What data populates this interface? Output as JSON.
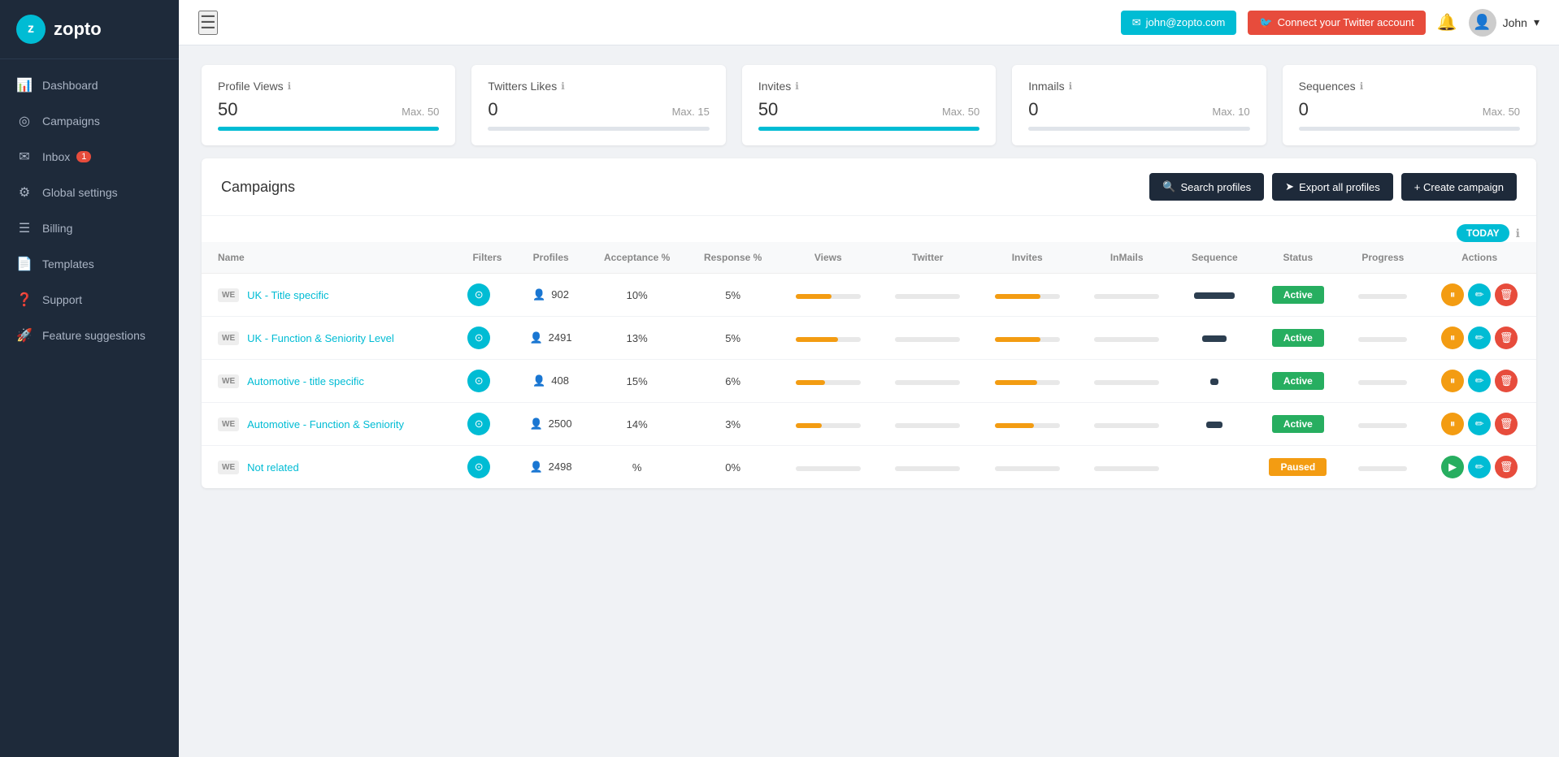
{
  "app": {
    "name": "zopto",
    "logo_letter": "z"
  },
  "topbar": {
    "hamburger_label": "☰",
    "email_btn": "john@zopto.com",
    "twitter_btn": "Connect your Twitter account",
    "user_name": "John",
    "bell_icon": "🔔"
  },
  "sidebar": {
    "items": [
      {
        "id": "dashboard",
        "label": "Dashboard",
        "icon": "📊",
        "badge": null
      },
      {
        "id": "campaigns",
        "label": "Campaigns",
        "icon": "◎",
        "badge": null
      },
      {
        "id": "inbox",
        "label": "Inbox",
        "icon": "✉",
        "badge": "1"
      },
      {
        "id": "global-settings",
        "label": "Global settings",
        "icon": "⚙",
        "badge": null
      },
      {
        "id": "billing",
        "label": "Billing",
        "icon": "☰",
        "badge": null
      },
      {
        "id": "templates",
        "label": "Templates",
        "icon": "📄",
        "badge": null
      },
      {
        "id": "support",
        "label": "Support",
        "icon": "?",
        "badge": null
      },
      {
        "id": "feature-suggestions",
        "label": "Feature suggestions",
        "icon": "🚀",
        "badge": null
      }
    ]
  },
  "stats": [
    {
      "id": "profile-views",
      "title": "Profile Views",
      "value": "50",
      "max_label": "Max. 50",
      "fill_pct": 100,
      "fill_color": "#00bcd4"
    },
    {
      "id": "twitter-likes",
      "title": "Twitters Likes",
      "value": "0",
      "max_label": "Max. 15",
      "fill_pct": 0,
      "fill_color": "#00bcd4"
    },
    {
      "id": "invites",
      "title": "Invites",
      "value": "50",
      "max_label": "Max. 50",
      "fill_pct": 100,
      "fill_color": "#00bcd4"
    },
    {
      "id": "inmails",
      "title": "Inmails",
      "value": "0",
      "max_label": "Max. 10",
      "fill_pct": 0,
      "fill_color": "#00bcd4"
    },
    {
      "id": "sequences",
      "title": "Sequences",
      "value": "0",
      "max_label": "Max. 50",
      "fill_pct": 0,
      "fill_color": "#00bcd4"
    }
  ],
  "campaigns_section": {
    "title": "Campaigns",
    "search_btn": "Search profiles",
    "export_btn": "Export all profiles",
    "create_btn": "+ Create campaign",
    "today_toggle": "TODAY",
    "table_headers": [
      "Name",
      "Filters",
      "Profiles",
      "Acceptance %",
      "Response %",
      "Views",
      "Twitter",
      "Invites",
      "InMails",
      "Sequence",
      "Status",
      "Progress",
      "Actions"
    ],
    "rows": [
      {
        "id": "row1",
        "badge": "WE",
        "name": "UK - Title specific",
        "profiles": "902",
        "acceptance": "10%",
        "response": "5%",
        "views_fill": 55,
        "views_color": "#f39c12",
        "twitter_fill": 0,
        "invites_fill": 70,
        "invites_color": "#f39c12",
        "inmails_fill": 0,
        "sequence_size": "lg",
        "status": "Active",
        "status_class": "status-active"
      },
      {
        "id": "row2",
        "badge": "WE",
        "name": "UK - Function & Seniority Level",
        "profiles": "2491",
        "acceptance": "13%",
        "response": "5%",
        "views_fill": 65,
        "views_color": "#f39c12",
        "twitter_fill": 0,
        "invites_fill": 70,
        "invites_color": "#f39c12",
        "inmails_fill": 0,
        "sequence_size": "md",
        "status": "Active",
        "status_class": "status-active"
      },
      {
        "id": "row3",
        "badge": "WE",
        "name": "Automotive - title specific",
        "profiles": "408",
        "acceptance": "15%",
        "response": "6%",
        "views_fill": 45,
        "views_color": "#f39c12",
        "twitter_fill": 0,
        "invites_fill": 65,
        "invites_color": "#f39c12",
        "inmails_fill": 0,
        "sequence_size": "xs",
        "status": "Active",
        "status_class": "status-active"
      },
      {
        "id": "row4",
        "badge": "WE",
        "name": "Automotive - Function & Seniority",
        "profiles": "2500",
        "acceptance": "14%",
        "response": "3%",
        "views_fill": 40,
        "views_color": "#f39c12",
        "twitter_fill": 0,
        "invites_fill": 60,
        "invites_color": "#f39c12",
        "inmails_fill": 0,
        "sequence_size": "sm",
        "status": "Active",
        "status_class": "status-active"
      },
      {
        "id": "row5",
        "badge": "WE",
        "name": "Not related",
        "profiles": "2498",
        "acceptance": "%",
        "response": "0%",
        "views_fill": 0,
        "views_color": "#e8e8e8",
        "twitter_fill": 0,
        "invites_fill": 0,
        "invites_color": "#e8e8e8",
        "inmails_fill": 0,
        "sequence_size": "none",
        "status": "Paused",
        "status_class": "status-paused"
      }
    ]
  }
}
